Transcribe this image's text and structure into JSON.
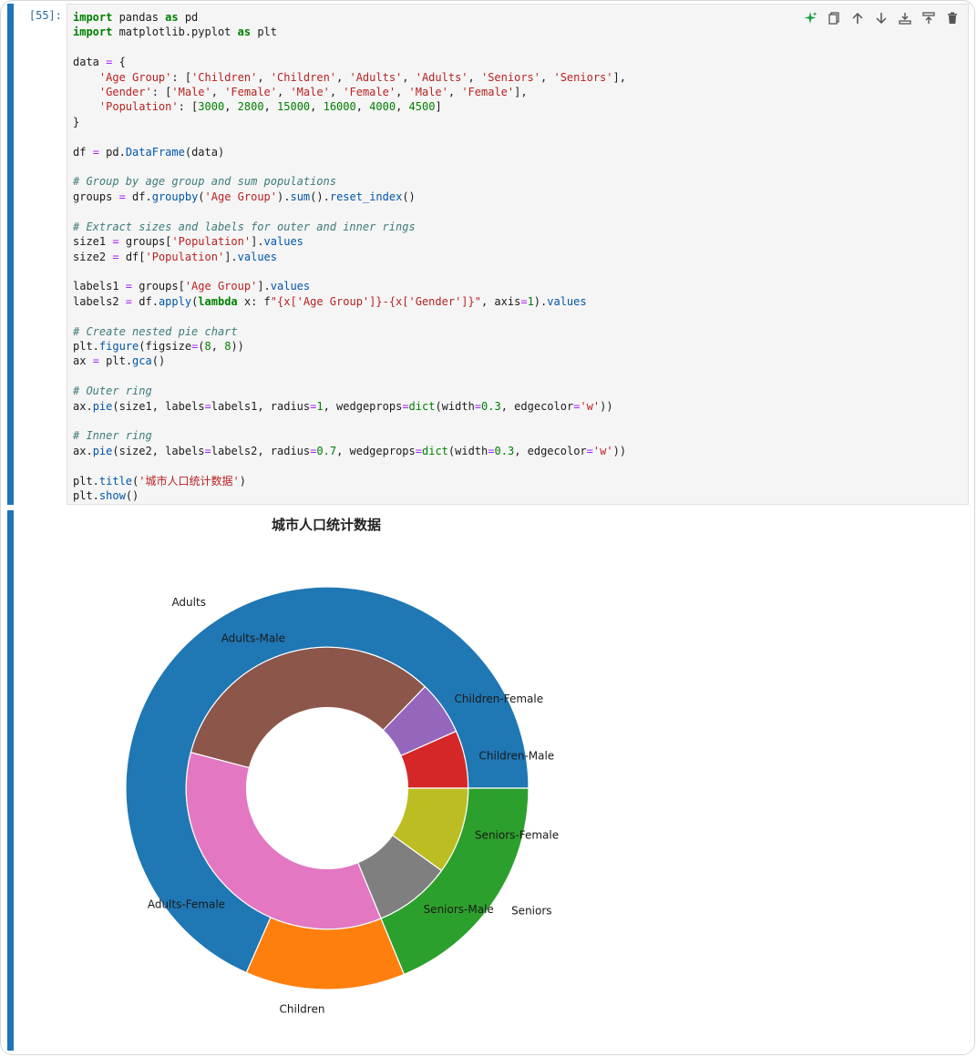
{
  "cell": {
    "prompt": "[55]:",
    "toolbar": [
      "sparkle-icon",
      "copy-icon",
      "move-up-icon",
      "move-down-icon",
      "insert-above-icon",
      "insert-below-icon",
      "delete-icon"
    ],
    "code_lines": [
      "import pandas as pd",
      "import matplotlib.pyplot as plt",
      "",
      "data = {",
      "    'Age Group': ['Children', 'Children', 'Adults', 'Adults', 'Seniors', 'Seniors'],",
      "    'Gender': ['Male', 'Female', 'Male', 'Female', 'Male', 'Female'],",
      "    'Population': [3000, 2800, 15000, 16000, 4000, 4500]",
      "}",
      "",
      "df = pd.DataFrame(data)",
      "",
      "# Group by age group and sum populations",
      "groups = df.groupby('Age Group').sum().reset_index()",
      "",
      "# Extract sizes and labels for outer and inner rings",
      "size1 = groups['Population'].values",
      "size2 = df['Population'].values",
      "",
      "labels1 = groups['Age Group'].values",
      "labels2 = df.apply(lambda x: f\"{x['Age Group']}-{x['Gender']}\", axis=1).values",
      "",
      "# Create nested pie chart",
      "plt.figure(figsize=(8, 8))",
      "ax = plt.gca()",
      "",
      "# Outer ring",
      "ax.pie(size1, labels=labels1, radius=1, wedgeprops=dict(width=0.3, edgecolor='w'))",
      "",
      "# Inner ring",
      "ax.pie(size2, labels=labels2, radius=0.7, wedgeprops=dict(width=0.3, edgecolor='w'))",
      "",
      "plt.title('城市人口统计数据')",
      "plt.show()"
    ]
  },
  "chart_data": {
    "type": "pie",
    "title": "城市人口统计数据",
    "rings": [
      {
        "name": "outer",
        "categories": [
          "Adults",
          "Children",
          "Seniors"
        ],
        "values": [
          31000,
          5800,
          8500
        ],
        "colors": [
          "#1f77b4",
          "#ff7f0e",
          "#2ca02c"
        ]
      },
      {
        "name": "inner",
        "categories": [
          "Children-Male",
          "Children-Female",
          "Adults-Male",
          "Adults-Female",
          "Seniors-Male",
          "Seniors-Female"
        ],
        "values": [
          3000,
          2800,
          15000,
          16000,
          4000,
          4500
        ],
        "colors": [
          "#d62728",
          "#9467bd",
          "#8c564b",
          "#e377c2",
          "#7f7f7f",
          "#bcbd22"
        ]
      }
    ]
  }
}
